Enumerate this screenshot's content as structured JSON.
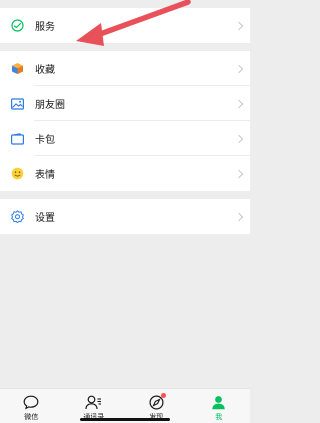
{
  "menu": {
    "services": {
      "label": "服务",
      "icon": "services-icon"
    },
    "group2": [
      {
        "label": "收藏",
        "icon": "favorites-icon"
      },
      {
        "label": "朋友圈",
        "icon": "moments-icon"
      },
      {
        "label": "卡包",
        "icon": "card-wallet-icon"
      },
      {
        "label": "表情",
        "icon": "sticker-icon"
      }
    ],
    "settings": {
      "label": "设置",
      "icon": "settings-icon"
    }
  },
  "tabbar": {
    "tabs": [
      {
        "label": "微信",
        "icon": "chat-icon",
        "active": false
      },
      {
        "label": "通讯录",
        "icon": "contacts-icon",
        "active": false
      },
      {
        "label": "发现",
        "icon": "discover-icon",
        "active": false,
        "badge": true
      },
      {
        "label": "我",
        "icon": "me-icon",
        "active": true
      }
    ]
  },
  "colors": {
    "accent": "#07c160",
    "annotation_arrow": "#e8515a",
    "badge": "#fa5151"
  }
}
